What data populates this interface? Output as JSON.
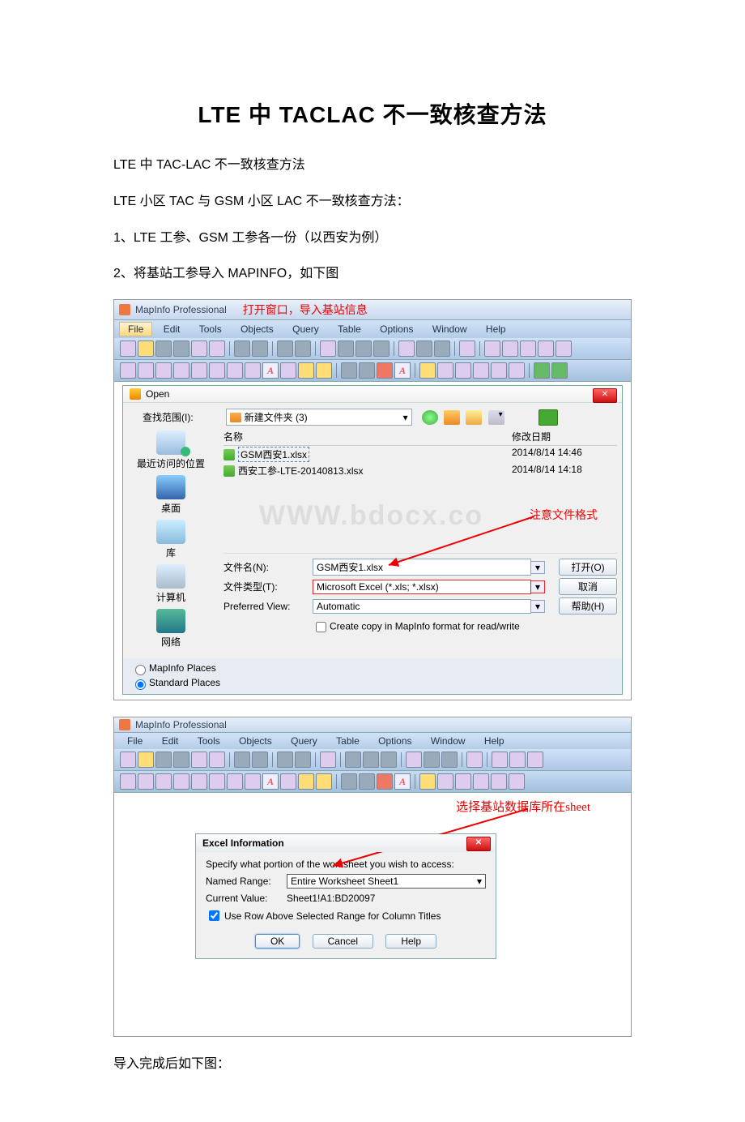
{
  "doc": {
    "title": "LTE 中 TACLAC 不一致核查方法",
    "p1": "LTE 中 TAC-LAC 不一致核查方法",
    "p2": "LTE 小区 TAC 与 GSM 小区 LAC 不一致核查方法：",
    "p3": "1、LTE 工参、GSM 工参各一份（以西安为例）",
    "p4": "2、将基站工参导入 MAPINFO，如下图",
    "p5": "导入完成后如下图："
  },
  "shot1": {
    "app_title": "MapInfo Professional",
    "annotation": "打开窗口，导入基站信息",
    "menu": [
      "File",
      "Edit",
      "Tools",
      "Objects",
      "Query",
      "Table",
      "Options",
      "Window",
      "Help"
    ],
    "open_dialog": {
      "title": "Open",
      "look_in_label": "查找范围(I):",
      "folder": "新建文件夹 (3)",
      "sidebar": {
        "recent": "最近访问的位置",
        "desktop": "桌面",
        "lib": "库",
        "pc": "计算机",
        "net": "网络"
      },
      "columns": {
        "name": "名称",
        "date": "修改日期"
      },
      "files": [
        {
          "name": "GSM西安1.xlsx",
          "date": "2014/8/14 14:46",
          "selected": true
        },
        {
          "name": "西安工参-LTE-20140813.xlsx",
          "date": "2014/8/14 14:18",
          "selected": false
        }
      ],
      "watermark": "WWW.bdocx.co",
      "ann_format": "注意文件格式",
      "filename_label": "文件名(N):",
      "filename_value": "GSM西安1.xlsx",
      "filetype_label": "文件类型(T):",
      "filetype_value": "Microsoft Excel (*.xls; *.xlsx)",
      "prefview_label": "Preferred View:",
      "prefview_value": "Automatic",
      "btn_open": "打开(O)",
      "btn_cancel": "取消",
      "btn_help": "帮助(H)",
      "chk_copy": "Create copy in MapInfo format for read/write",
      "radio1": "MapInfo Places",
      "radio2": "Standard Places"
    }
  },
  "shot2": {
    "app_title": "MapInfo Professional",
    "menu": [
      "File",
      "Edit",
      "Tools",
      "Objects",
      "Query",
      "Table",
      "Options",
      "Window",
      "Help"
    ],
    "annotation": "选择基站数据库所在sheet",
    "excel_dialog": {
      "title": "Excel Information",
      "instr": "Specify what portion of the worksheet you wish to access:",
      "named_label": "Named Range:",
      "named_value": "Entire Worksheet Sheet1",
      "current_label": "Current Value:",
      "current_value": "Sheet1!A1:BD20097",
      "chk": "Use Row Above Selected Range for Column Titles",
      "ok": "OK",
      "cancel": "Cancel",
      "help": "Help"
    }
  }
}
